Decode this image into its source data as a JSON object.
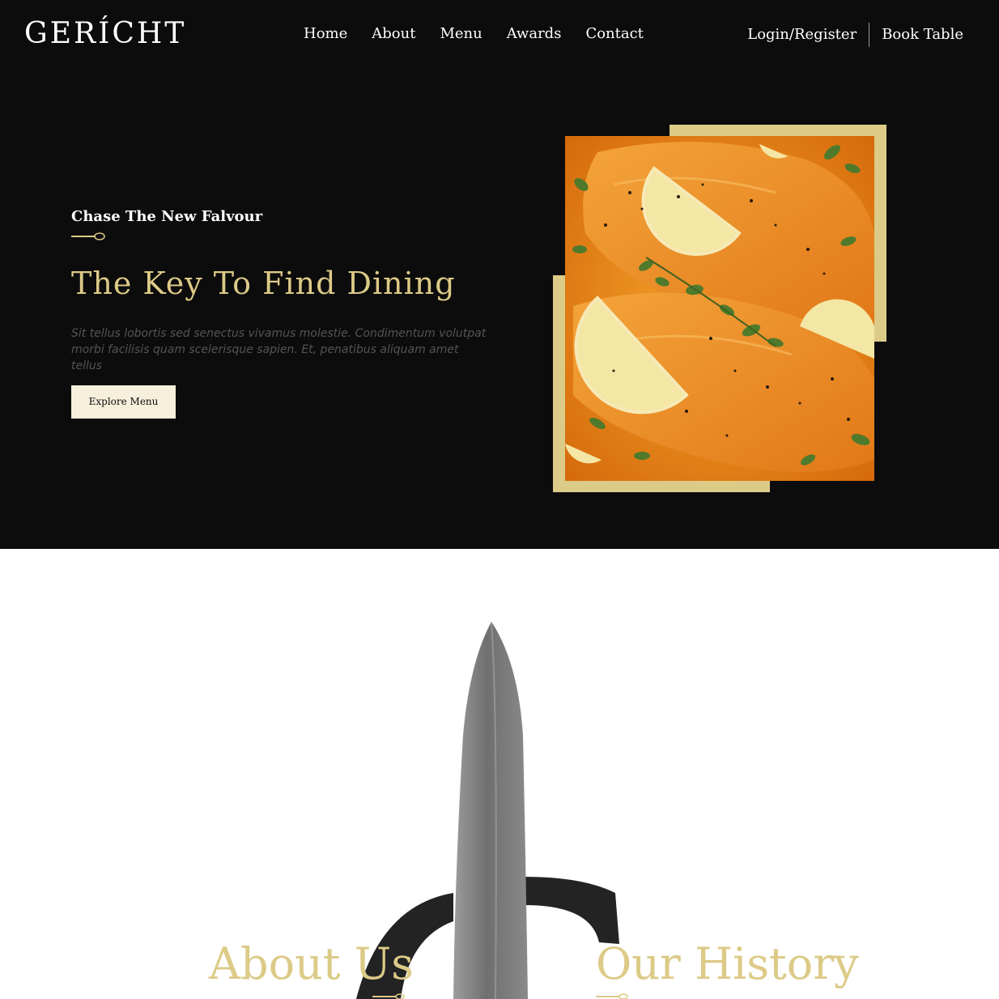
{
  "nav": {
    "logo": "GERÍCHT",
    "links": [
      "Home",
      "About",
      "Menu",
      "Awards",
      "Contact"
    ],
    "login": "Login/Register",
    "book": "Book Table"
  },
  "hero": {
    "subtitle": "Chase The New Falvour",
    "title": "The Key To Find Dining",
    "paragraph": "Sit tellus lobortis sed senectus vivamus molestie. Condimentum volutpat morbi facilisis quam scelerisque sapien. Et, penatibus aliquam amet tellus",
    "button": "Explore Menu"
  },
  "about": {
    "title": "About Us",
    "history_title": "Our History"
  },
  "colors": {
    "accent": "#dcca87",
    "background": "#0c0c0c",
    "button_bg": "#f5efdb"
  },
  "icons": [
    "spoon-icon",
    "knife-graphic"
  ]
}
